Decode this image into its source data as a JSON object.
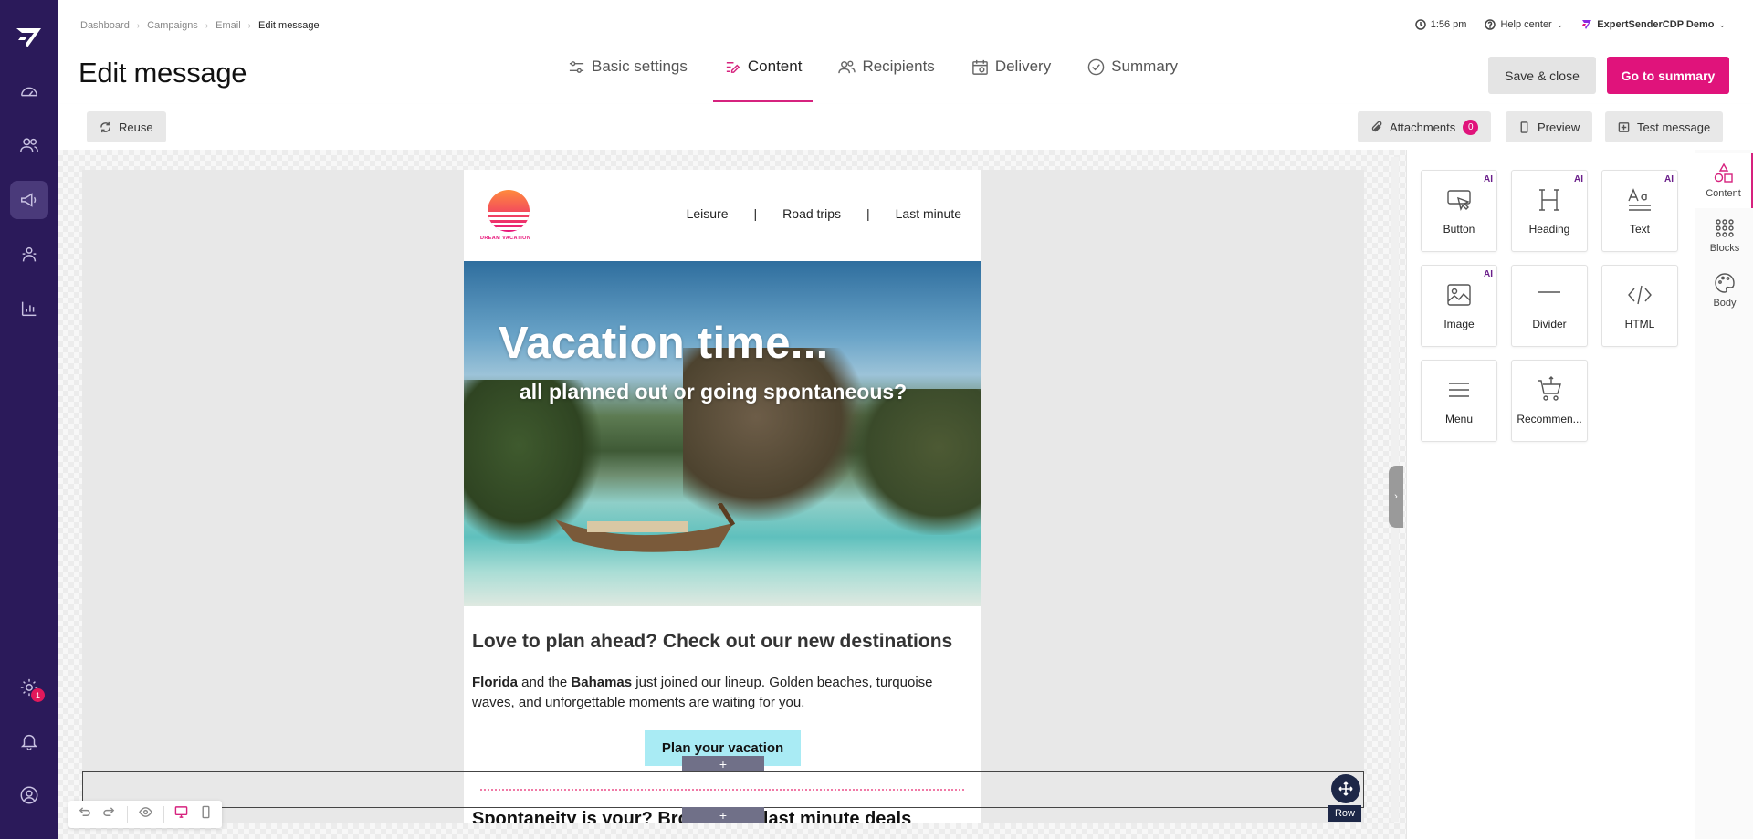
{
  "breadcrumb": [
    "Dashboard",
    "Campaigns",
    "Email",
    "Edit message"
  ],
  "page_title": "Edit message",
  "header": {
    "time": "1:56 pm",
    "help": "Help center",
    "account": "ExpertSenderCDP Demo"
  },
  "tabs": [
    {
      "label": "Basic settings",
      "icon": "sliders-icon"
    },
    {
      "label": "Content",
      "icon": "edit-icon",
      "active": true
    },
    {
      "label": "Recipients",
      "icon": "users-icon"
    },
    {
      "label": "Delivery",
      "icon": "calendar-icon"
    },
    {
      "label": "Summary",
      "icon": "check-circle-icon"
    }
  ],
  "actions": {
    "save_close": "Save & close",
    "go_summary": "Go to summary"
  },
  "toolbar": {
    "reuse": "Reuse",
    "attachments": "Attachments",
    "attachments_count": "0",
    "preview": "Preview",
    "test_message": "Test message"
  },
  "sidebar": {
    "settings_badge": "1"
  },
  "email": {
    "brand": "DREAM VACATION",
    "nav": [
      "Leisure",
      "|",
      "Road trips",
      "|",
      "Last minute"
    ],
    "hero_title": "Vacation time...",
    "hero_sub": "all planned out or going spontaneous?",
    "h2": "Love to plan ahead? Check out our new destinations",
    "p_bold1": "Florida",
    "p_text1": " and the ",
    "p_bold2": "Bahamas",
    "p_text2": " just joined our lineup. Golden beaches, turquoise waves, and unforgettable moments are waiting for you.",
    "cta": "Plan your vacation",
    "h2_partial": "Spontaneity is your? Browse our last minute deals"
  },
  "editor": {
    "row_label": "Row",
    "plus": "+"
  },
  "content_tiles": [
    {
      "label": "Button",
      "icon": "pointer-icon",
      "ai": true
    },
    {
      "label": "Heading",
      "icon": "heading-icon",
      "ai": true
    },
    {
      "label": "Text",
      "icon": "text-icon",
      "ai": true
    },
    {
      "label": "Image",
      "icon": "image-icon",
      "ai": true
    },
    {
      "label": "Divider",
      "icon": "divider-icon",
      "ai": false
    },
    {
      "label": "HTML",
      "icon": "code-icon",
      "ai": false
    },
    {
      "label": "Menu",
      "icon": "menu-icon",
      "ai": false
    },
    {
      "label": "Recommen...",
      "icon": "cart-icon",
      "ai": false
    }
  ],
  "ai_badge": "AI",
  "right_tabs": [
    {
      "label": "Content",
      "icon": "shapes-icon",
      "active": true
    },
    {
      "label": "Blocks",
      "icon": "grid-icon"
    },
    {
      "label": "Body",
      "icon": "palette-icon"
    }
  ],
  "colors": {
    "accent": "#e0137b",
    "sidebar": "#2b1a5a",
    "cta_bg": "#a9ebf4"
  }
}
